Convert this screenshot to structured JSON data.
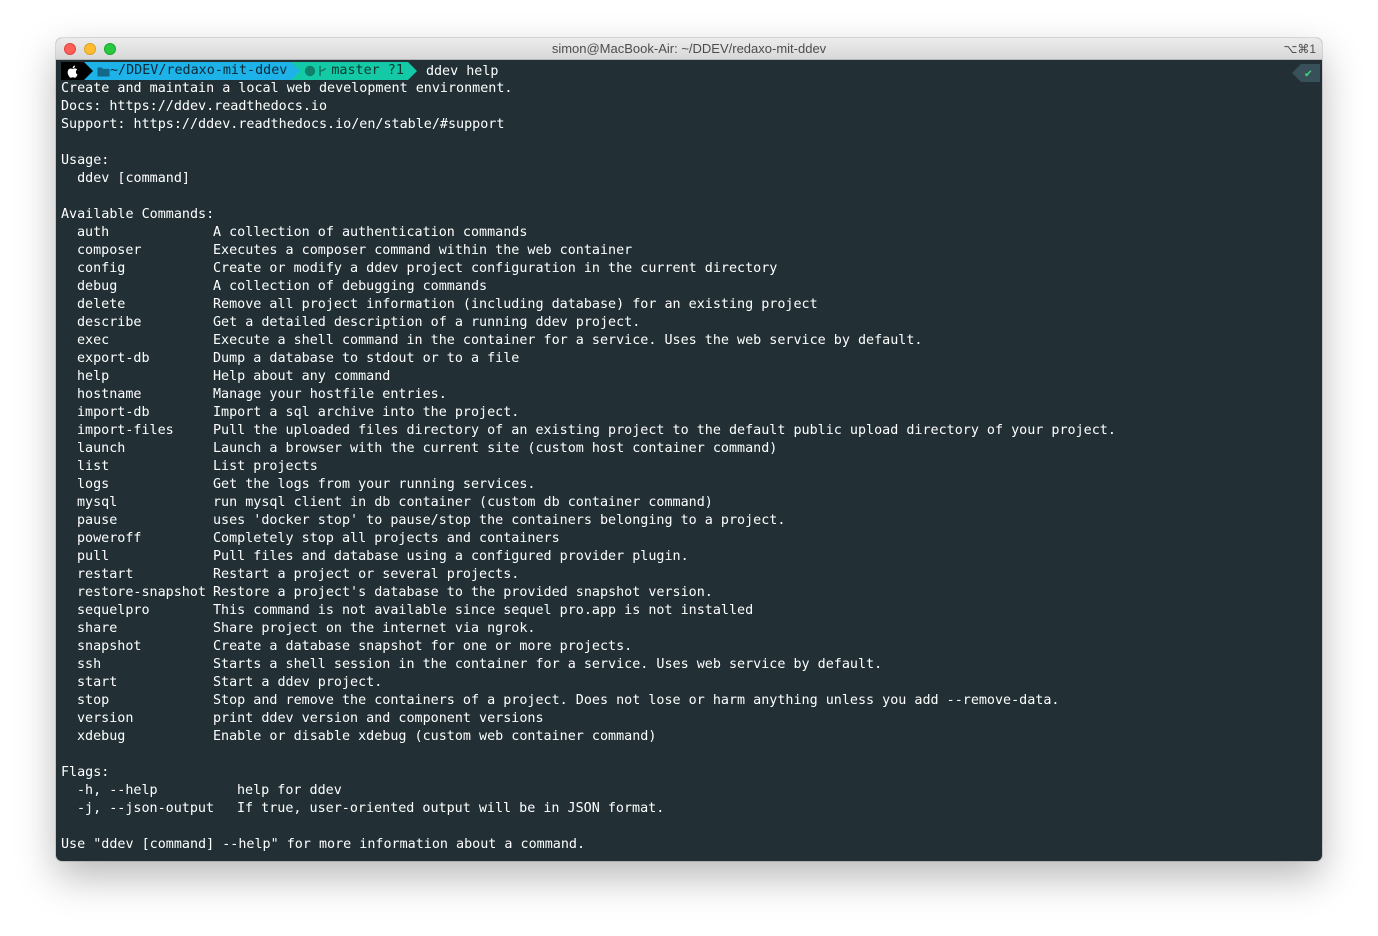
{
  "window": {
    "title": "simon@MacBook-Air: ~/DDEV/redaxo-mit-ddev",
    "shortcut": "⌥⌘1"
  },
  "prompt": {
    "os_icon": "apple-icon",
    "dir_icon": "folder-icon",
    "dir": "~/DDEV/redaxo-mit-ddev",
    "git_icons": "github-icon branch-icon",
    "git": "master ?1",
    "command": "ddev help",
    "status": "✔"
  },
  "intro": [
    "Create and maintain a local web development environment.",
    "Docs: https://ddev.readthedocs.io",
    "Support: https://ddev.readthedocs.io/en/stable/#support"
  ],
  "usage": {
    "heading": "Usage:",
    "line": "  ddev [command]"
  },
  "commands_heading": "Available Commands:",
  "commands": [
    {
      "name": "auth",
      "desc": "A collection of authentication commands"
    },
    {
      "name": "composer",
      "desc": "Executes a composer command within the web container"
    },
    {
      "name": "config",
      "desc": "Create or modify a ddev project configuration in the current directory"
    },
    {
      "name": "debug",
      "desc": "A collection of debugging commands"
    },
    {
      "name": "delete",
      "desc": "Remove all project information (including database) for an existing project"
    },
    {
      "name": "describe",
      "desc": "Get a detailed description of a running ddev project."
    },
    {
      "name": "exec",
      "desc": "Execute a shell command in the container for a service. Uses the web service by default."
    },
    {
      "name": "export-db",
      "desc": "Dump a database to stdout or to a file"
    },
    {
      "name": "help",
      "desc": "Help about any command"
    },
    {
      "name": "hostname",
      "desc": "Manage your hostfile entries."
    },
    {
      "name": "import-db",
      "desc": "Import a sql archive into the project."
    },
    {
      "name": "import-files",
      "desc": "Pull the uploaded files directory of an existing project to the default public upload directory of your project."
    },
    {
      "name": "launch",
      "desc": "Launch a browser with the current site (custom host container command)"
    },
    {
      "name": "list",
      "desc": "List projects"
    },
    {
      "name": "logs",
      "desc": "Get the logs from your running services."
    },
    {
      "name": "mysql",
      "desc": "run mysql client in db container (custom db container command)"
    },
    {
      "name": "pause",
      "desc": "uses 'docker stop' to pause/stop the containers belonging to a project."
    },
    {
      "name": "poweroff",
      "desc": "Completely stop all projects and containers"
    },
    {
      "name": "pull",
      "desc": "Pull files and database using a configured provider plugin."
    },
    {
      "name": "restart",
      "desc": "Restart a project or several projects."
    },
    {
      "name": "restore-snapshot",
      "desc": "Restore a project's database to the provided snapshot version."
    },
    {
      "name": "sequelpro",
      "desc": "This command is not available since sequel pro.app is not installed"
    },
    {
      "name": "share",
      "desc": "Share project on the internet via ngrok."
    },
    {
      "name": "snapshot",
      "desc": "Create a database snapshot for one or more projects."
    },
    {
      "name": "ssh",
      "desc": "Starts a shell session in the container for a service. Uses web service by default."
    },
    {
      "name": "start",
      "desc": "Start a ddev project."
    },
    {
      "name": "stop",
      "desc": "Stop and remove the containers of a project. Does not lose or harm anything unless you add --remove-data."
    },
    {
      "name": "version",
      "desc": "print ddev version and component versions"
    },
    {
      "name": "xdebug",
      "desc": "Enable or disable xdebug (custom web container command)"
    }
  ],
  "flags_heading": "Flags:",
  "flags": [
    {
      "name": "-h, --help",
      "desc": "help for ddev"
    },
    {
      "name": "-j, --json-output",
      "desc": "If true, user-oriented output will be in JSON format."
    }
  ],
  "footer": "Use \"ddev [command] --help\" for more information about a command."
}
